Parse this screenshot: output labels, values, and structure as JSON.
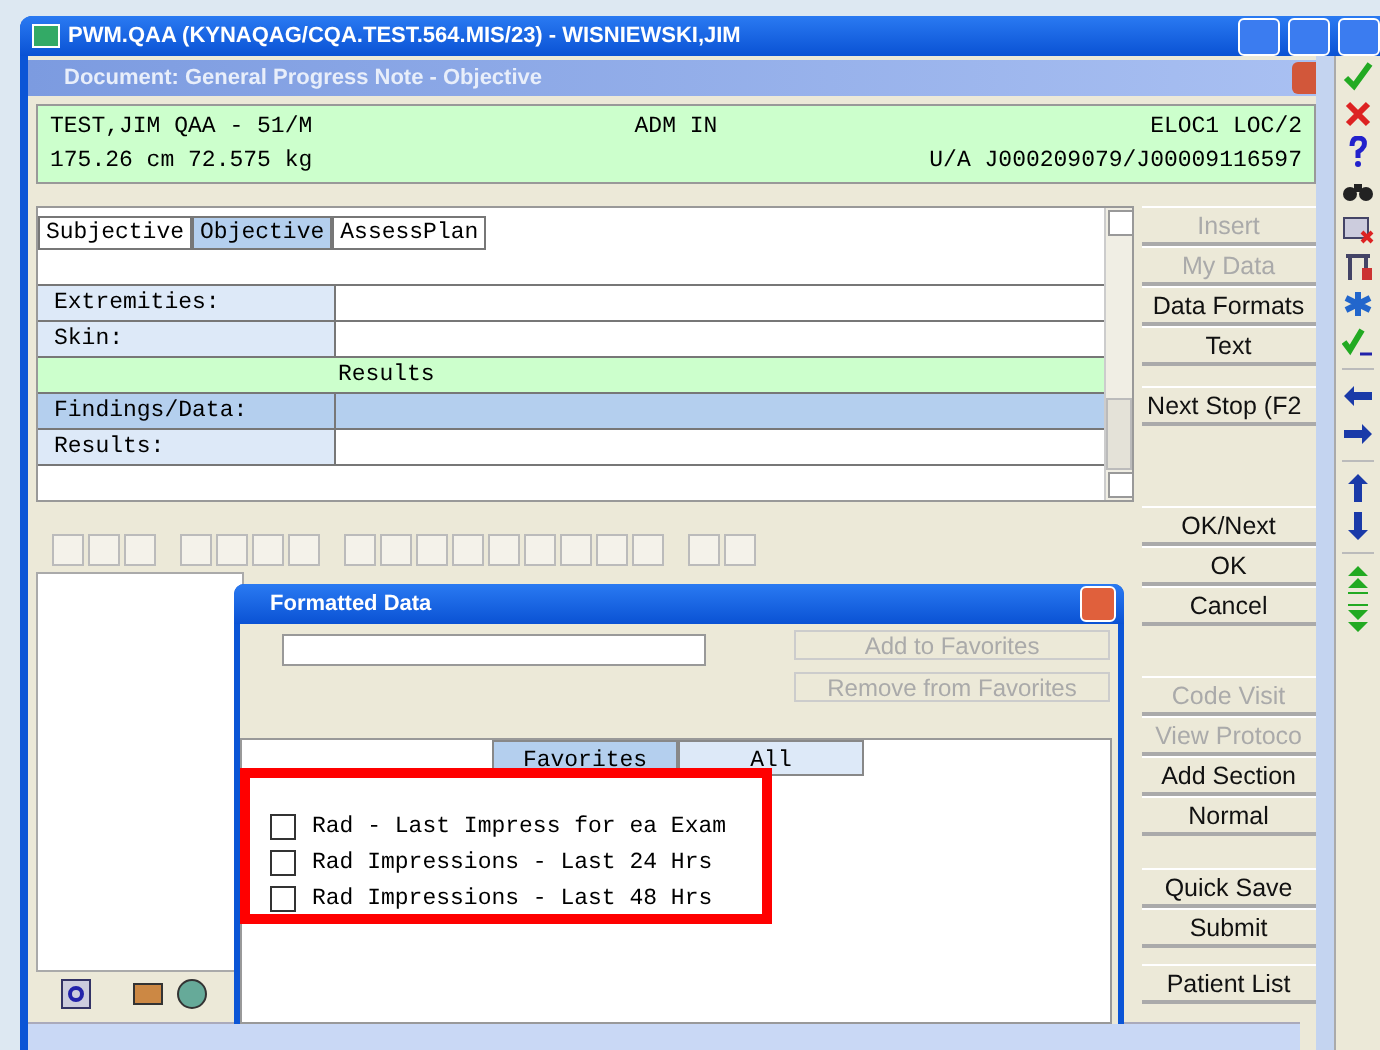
{
  "window": {
    "title": "PWM.QAA (KYNAQAG/CQA.TEST.564.MIS/23) - WISNIEWSKI,JIM"
  },
  "document": {
    "title": "Document: General Progress Note - Objective"
  },
  "patient_header": {
    "name_age": "TEST,JIM QAA - 51/M",
    "status": "ADM IN",
    "location": "ELOC1 LOC/2",
    "measurements": "175.26 cm 72.575 kg",
    "account": "U/A J000209079/J00009116597"
  },
  "note_tabs": [
    {
      "label": "Subjective",
      "selected": false
    },
    {
      "label": "Objective",
      "selected": true
    },
    {
      "label": "AssessPlan",
      "selected": false
    }
  ],
  "form_rows": [
    {
      "kind": "field",
      "label": "Extremities:",
      "selected": false
    },
    {
      "kind": "field",
      "label": "Skin:",
      "selected": false
    },
    {
      "kind": "section",
      "label": "Results"
    },
    {
      "kind": "field",
      "label": "Findings/Data:",
      "selected": true
    },
    {
      "kind": "field",
      "label": "Results:",
      "selected": false
    }
  ],
  "side_button_groups": [
    [
      {
        "label": "Insert",
        "disabled": true
      },
      {
        "label": "My Data",
        "disabled": true
      },
      {
        "label": "Data Formats",
        "disabled": false
      },
      {
        "label": "Text",
        "disabled": false
      }
    ],
    [
      {
        "label": "Next Stop (F2",
        "disabled": false
      }
    ],
    [
      {
        "label": "OK/Next",
        "disabled": false
      },
      {
        "label": "OK",
        "disabled": false
      },
      {
        "label": "Cancel",
        "disabled": false
      }
    ],
    [
      {
        "label": "Code Visit",
        "disabled": true
      },
      {
        "label": "View Protoco",
        "disabled": true
      },
      {
        "label": "Add Section",
        "disabled": false
      },
      {
        "label": "Normal",
        "disabled": false
      }
    ],
    [
      {
        "label": "Quick Save",
        "disabled": false
      },
      {
        "label": "Submit",
        "disabled": false
      }
    ],
    [
      {
        "label": "Patient List",
        "disabled": false
      }
    ]
  ],
  "dialog": {
    "title": "Formatted Data",
    "buttons": [
      {
        "label": "Add to Favorites",
        "disabled": true
      },
      {
        "label": "Remove from Favorites",
        "disabled": true
      }
    ],
    "tabs": [
      {
        "label": "Favorites",
        "selected": true
      },
      {
        "label": "All",
        "selected": false
      }
    ],
    "items": [
      {
        "label": "Rad - Last Impress for ea Exam",
        "checked": false
      },
      {
        "label": "Rad Impressions - Last 24 Hrs",
        "checked": false
      },
      {
        "label": "Rad Impressions - Last 48 Hrs",
        "checked": false
      }
    ]
  }
}
